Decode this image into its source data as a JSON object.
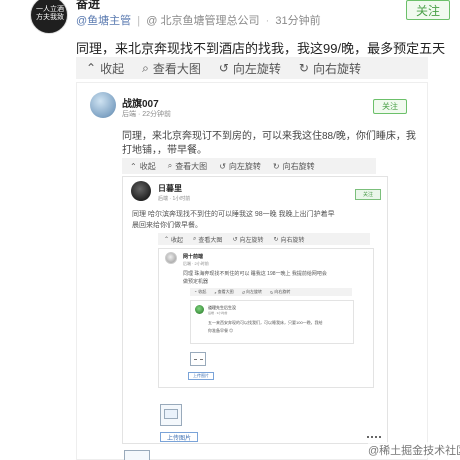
{
  "top_post": {
    "avatar_text": "一人立酒方夫我致",
    "title_partial": "奋进",
    "author": "@鱼塘主管",
    "location": "@ 北京鱼塘管理总公司",
    "time": "31分钟前",
    "follow": "关注",
    "content": "同理，来北京奔现找不到酒店的找我，我这99/晚，最多预定五天"
  },
  "toolbar": {
    "collapse": "收起",
    "view_large": "查看大图",
    "rotate_left": "向左旋转",
    "rotate_right": "向右旋转"
  },
  "nested1": {
    "name": "战旗007",
    "meta": "后端 · 22分钟前",
    "follow": "关注",
    "content_line1": "同理，来北京奔现订不到房的，可以来我这住88/晚，你们睡床，我",
    "content_line2": "打地铺，，带早餐。",
    "toolbar": {
      "collapse": "收起",
      "view_large": "查看大图",
      "rotate_left": "向左旋转",
      "rotate_right": "向右旋转"
    }
  },
  "nested2": {
    "name": "日暮里",
    "meta": "后端 · 1小时前",
    "follow": "关注",
    "content_line1": "同理 哈尔滨奔现找不到住的可以睡我这 98一晚 我晚上出门护着早",
    "content_line2": "晨回来给你们做早餐。",
    "toolbar": {
      "collapse": "收起",
      "view_large": "查看大图",
      "rotate_left": "向左旋转",
      "rotate_right": "向右旋转"
    }
  },
  "nested3": {
    "name": "网十前端",
    "meta": "后端 · 2小时前",
    "content_line1": "同理 珠海奔现找不到住的可以 睡我这 198一晚上 我提前给网吧会",
    "content_line2": "做预定机器",
    "toolbar": {
      "collapse": "收起",
      "view_large": "查看大图",
      "rotate_left": "向左旋转",
      "rotate_right": "向右旋转"
    }
  },
  "nested4": {
    "name": "道理先生后生没",
    "meta": "后端 · 3小时前",
    "content_line1": "五一来西安奔现的可以找我们，可以睡我床，只要100一晚，我给",
    "content_line2": "你准备早餐 😊"
  },
  "tags": {
    "upload1": "上传图片",
    "upload2": "上传图片"
  },
  "watermark": "@稀土掘金技术社区"
}
